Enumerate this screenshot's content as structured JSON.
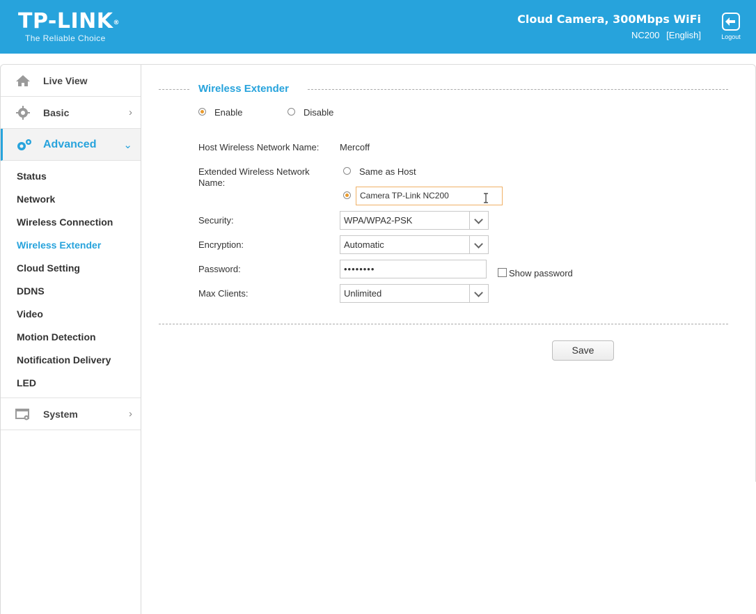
{
  "header": {
    "logo_text": "TP-LINK",
    "logo_reg": "®",
    "tagline": "The Reliable Choice",
    "product_name": "Cloud Camera, 300Mbps WiFi",
    "model": "NC200",
    "language": "[English]",
    "logout_label": "Logout",
    "background_color": "#27a3dc"
  },
  "sidebar": {
    "live_view": "Live View",
    "basic": "Basic",
    "advanced": "Advanced",
    "sub_items": [
      "Status",
      "Network",
      "Wireless Connection",
      "Wireless Extender",
      "Cloud Setting",
      "DDNS",
      "Video",
      "Motion Detection",
      "Notification Delivery",
      "LED"
    ],
    "active_sub_item": "Wireless Extender",
    "system": "System",
    "accent_color": "#27a3dc"
  },
  "form": {
    "section_title": "Wireless Extender",
    "enable_label": "Enable",
    "disable_label": "Disable",
    "enable_selected": true,
    "host_name_label": "Host Wireless Network Name:",
    "host_name_value": "Mercoff",
    "extended_name_label": "Extended Wireless Network Name:",
    "same_as_host_label": "Same as Host",
    "extended_name_value": "Camera TP-Link NC200",
    "security_label": "Security:",
    "security_value": "WPA/WPA2-PSK",
    "encryption_label": "Encryption:",
    "encryption_value": "Automatic",
    "password_label": "Password:",
    "password_value": "••••••••",
    "show_password_label": "Show password",
    "show_password_checked": false,
    "max_clients_label": "Max Clients:",
    "max_clients_value": "Unlimited",
    "save_label": "Save"
  }
}
